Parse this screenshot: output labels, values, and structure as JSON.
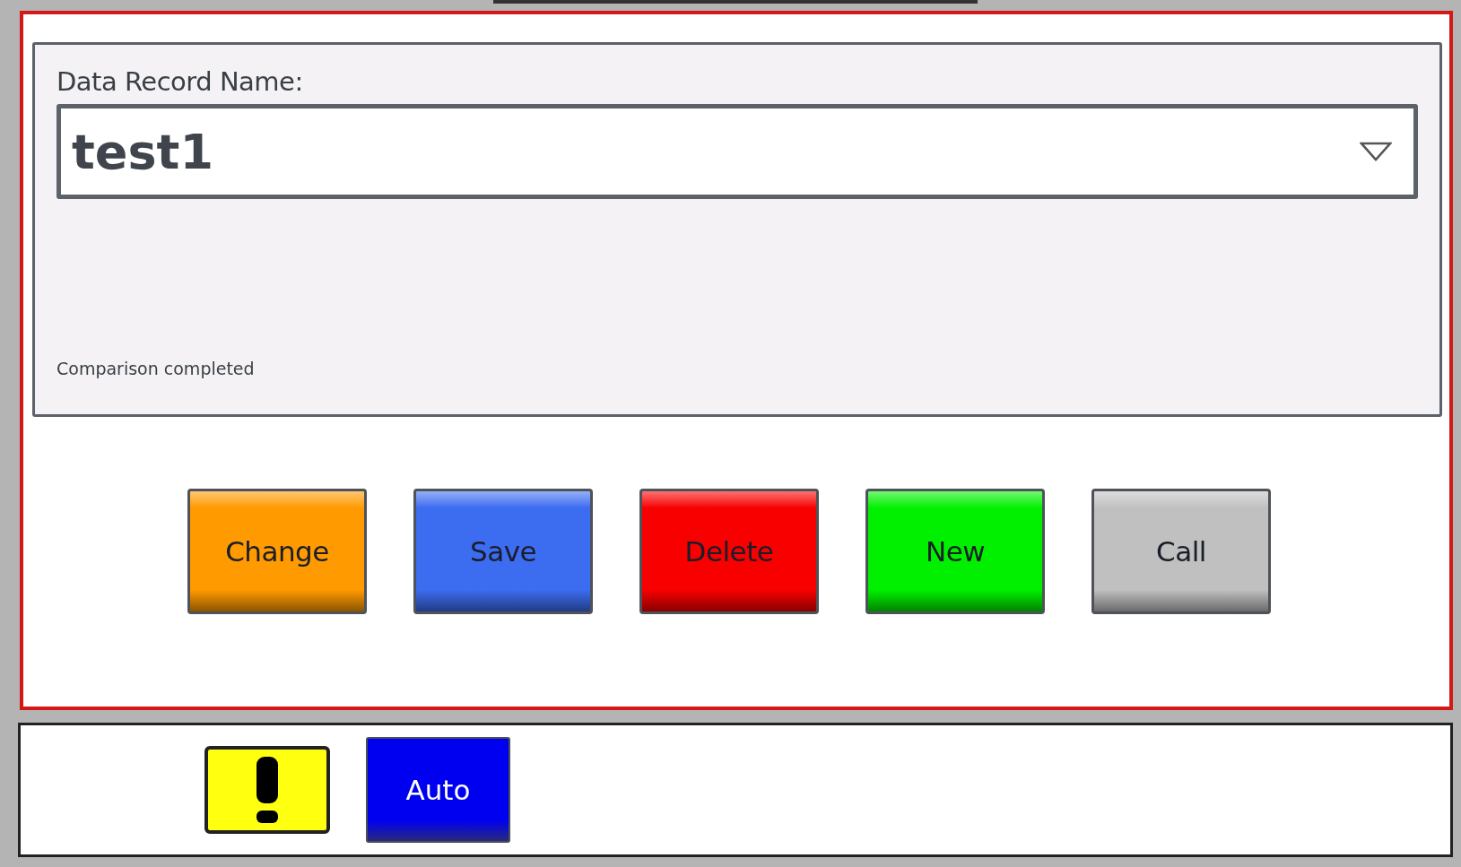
{
  "record_panel": {
    "label": "Data Record Name:",
    "value": "test1",
    "message": "Comparison completed"
  },
  "actions": [
    {
      "label": "Change",
      "color": "#ff9a00"
    },
    {
      "label": "Save",
      "color": "#3c6cf0"
    },
    {
      "label": "Delete",
      "color": "#f80000"
    },
    {
      "label": "New",
      "color": "#00f000"
    },
    {
      "label": "Call",
      "color": "#c0c0c0"
    }
  ],
  "status_bar": {
    "buttons": [
      {
        "kind": "warning"
      },
      {
        "kind": "text",
        "label": "Auto"
      }
    ]
  }
}
